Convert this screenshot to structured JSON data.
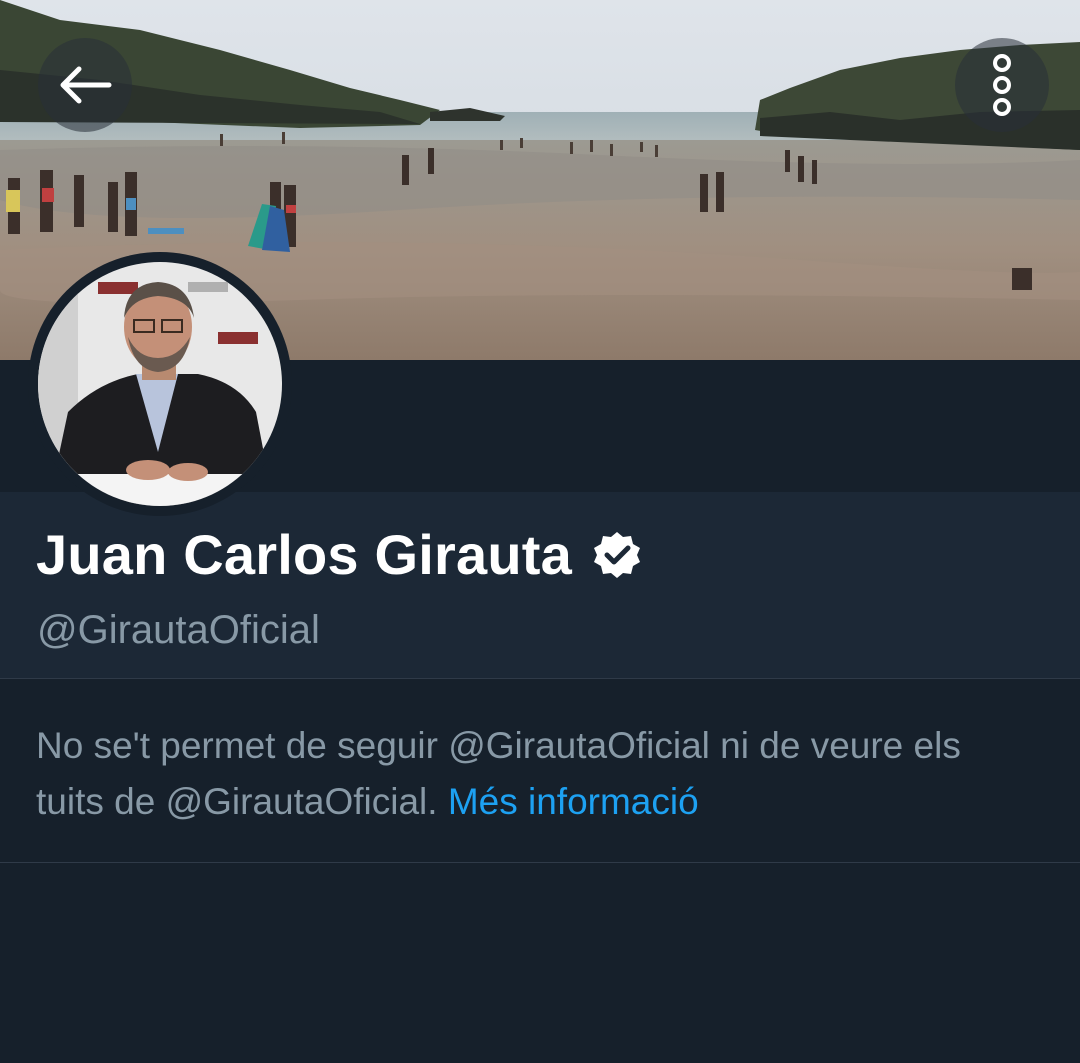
{
  "profile": {
    "display_name": "Juan Carlos Girauta",
    "handle": "@GirautaOficial",
    "verified": true
  },
  "notice": {
    "text": "No se't permet de seguir @GirautaOficial ni de veure els tuits de @GirautaOficial. ",
    "link_label": "Més informació"
  },
  "icons": {
    "back": "arrow-left-icon",
    "more": "more-vertical-icon",
    "verified": "verified-badge-icon"
  },
  "colors": {
    "background": "#16202b",
    "header": "#1c2836",
    "secondary_text": "#8899a6",
    "link": "#1da1f2"
  }
}
